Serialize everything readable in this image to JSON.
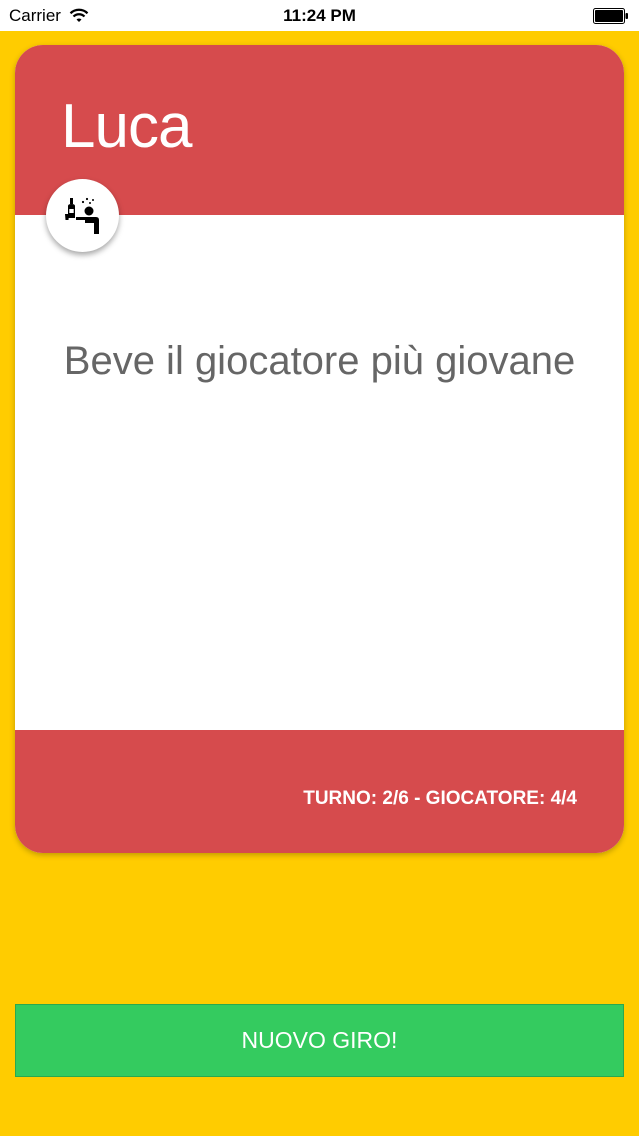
{
  "status_bar": {
    "carrier": "Carrier",
    "time": "11:24 PM"
  },
  "card": {
    "player_name": "Luca",
    "rule_text": "Beve il giocatore più giovane",
    "turn_info": "TURNO: 2/6 - GIOCATORE: 4/4",
    "icon": "drinking-person-icon"
  },
  "button": {
    "label": "NUOVO GIRO!"
  },
  "colors": {
    "background": "#FFCC00",
    "card_accent": "#D64B4D",
    "button": "#34CB5F"
  }
}
